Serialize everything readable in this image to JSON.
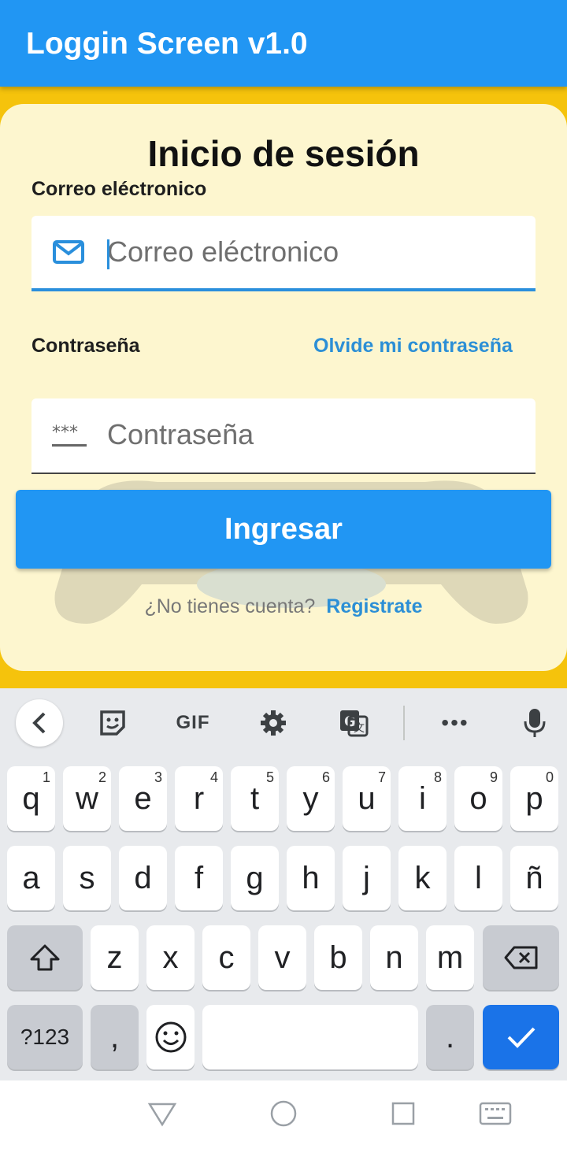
{
  "app": {
    "title": "Loggin Screen v1.0"
  },
  "login": {
    "heading": "Inicio de sesión",
    "email_label": "Correo eléctronico",
    "email_placeholder": "Correo eléctronico",
    "password_label": "Contraseña",
    "forgot_link": "Olvide mi contraseña",
    "password_placeholder": "Contraseña",
    "submit_label": "Ingresar",
    "no_account_text": "¿No tienes cuenta?",
    "register_link": "Registrate"
  },
  "keyboard": {
    "toolbar": {
      "gif_label": "GIF",
      "more_label": "•••"
    },
    "row1": [
      {
        "k": "q",
        "h": "1"
      },
      {
        "k": "w",
        "h": "2"
      },
      {
        "k": "e",
        "h": "3"
      },
      {
        "k": "r",
        "h": "4"
      },
      {
        "k": "t",
        "h": "5"
      },
      {
        "k": "y",
        "h": "6"
      },
      {
        "k": "u",
        "h": "7"
      },
      {
        "k": "i",
        "h": "8"
      },
      {
        "k": "o",
        "h": "9"
      },
      {
        "k": "p",
        "h": "0"
      }
    ],
    "row2": [
      "a",
      "s",
      "d",
      "f",
      "g",
      "h",
      "j",
      "k",
      "l",
      "ñ"
    ],
    "row3": [
      "z",
      "x",
      "c",
      "v",
      "b",
      "n",
      "m"
    ],
    "symbols_label": "?123",
    "comma_label": ",",
    "period_label": "."
  },
  "colors": {
    "primary": "#2196f3",
    "background": "#f5c30c",
    "card": "#fdf6cf",
    "link": "#2c8fd6"
  }
}
